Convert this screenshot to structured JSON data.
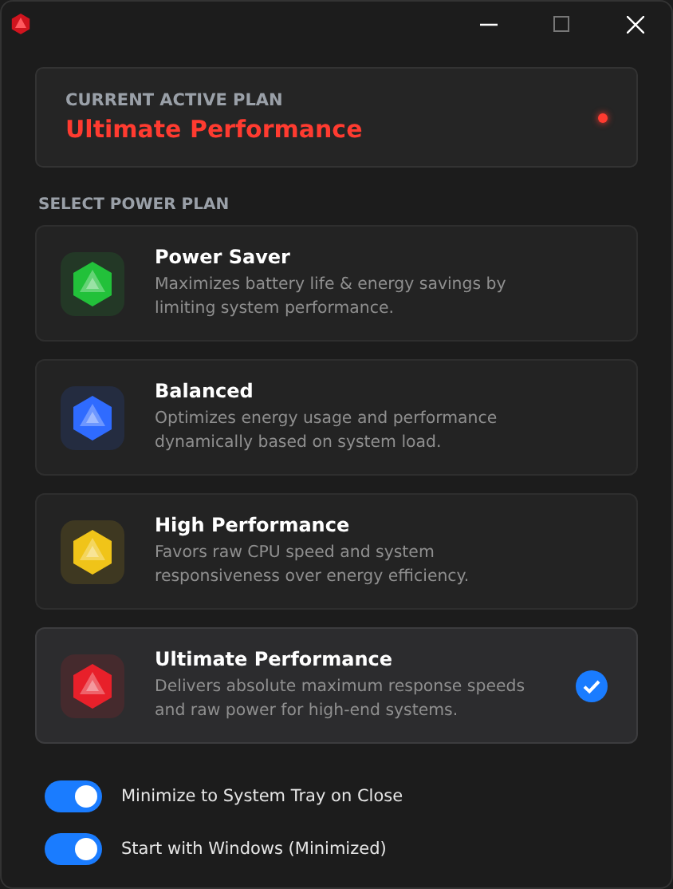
{
  "current_plan": {
    "label": "CURRENT ACTIVE PLAN",
    "name": "Ultimate Performance",
    "color": "#ff3b30"
  },
  "section_title": "SELECT POWER PLAN",
  "plans": [
    {
      "name": "Power Saver",
      "description": "Maximizes battery life & energy savings by limiting system performance.",
      "color": "#22c13a",
      "selected": false
    },
    {
      "name": "Balanced",
      "description": "Optimizes energy usage and performance dynamically based on system load.",
      "color": "#2f6bff",
      "selected": false
    },
    {
      "name": "High Performance",
      "description": "Favors raw CPU speed and system responsiveness over energy efficiency.",
      "color": "#f0c419",
      "selected": false
    },
    {
      "name": "Ultimate Performance",
      "description": "Delivers absolute maximum response speeds and raw power for high-end systems.",
      "color": "#e8202a",
      "selected": true
    }
  ],
  "settings": [
    {
      "label": "Minimize to System Tray on Close",
      "on": true
    },
    {
      "label": "Start with Windows (Minimized)",
      "on": true
    }
  ]
}
